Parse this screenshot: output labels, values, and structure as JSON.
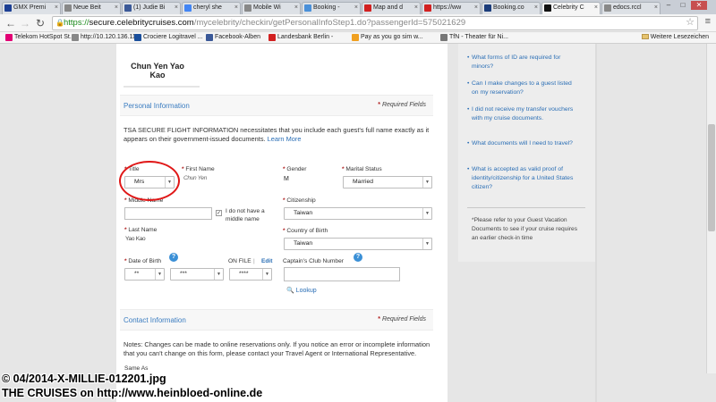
{
  "browser": {
    "tabs": [
      {
        "label": "GMX Premi",
        "favicon": "gmx-icon",
        "color": "#1c3f94",
        "active": false
      },
      {
        "label": "Neue Beit",
        "favicon": "page-icon",
        "color": "#888888",
        "active": false
      },
      {
        "label": "(1) Judie Bi",
        "favicon": "facebook-icon",
        "color": "#3b5998",
        "active": false
      },
      {
        "label": "cheryl she",
        "favicon": "search-icon",
        "color": "#4285f4",
        "active": false
      },
      {
        "label": "Mobile Wi",
        "favicon": "page-icon",
        "color": "#888888",
        "active": false
      },
      {
        "label": "Booking -",
        "favicon": "booking-icon",
        "color": "#4a90d9",
        "active": false
      },
      {
        "label": "Map and d",
        "favicon": "acrobat-icon",
        "color": "#d22020",
        "active": false
      },
      {
        "label": "https://ww",
        "favicon": "acrobat-icon",
        "color": "#d22020",
        "active": false
      },
      {
        "label": "Booking.co",
        "favicon": "booking-icon",
        "color": "#1b3c7a",
        "active": false
      },
      {
        "label": "Celebrity C",
        "favicon": "celebrity-x-icon",
        "color": "#111111",
        "active": true
      },
      {
        "label": "edocs.rccl",
        "favicon": "page-icon",
        "color": "#888888",
        "active": false
      }
    ],
    "url": {
      "https": "https://",
      "host": "secure.celebritycruises.com",
      "path": "/mycelebrity/checkin/getPersonalInfoStep1.do?passengerId=575021629"
    },
    "bookmarks": [
      {
        "label": "Telekom HotSpot St...",
        "color": "#e20074"
      },
      {
        "label": "http://10.120.136.11...",
        "color": "#888888"
      },
      {
        "label": "Crociere Logitravel ...",
        "color": "#1a4f9c"
      },
      {
        "label": "Facebook-Alben",
        "color": "#3b5998"
      },
      {
        "label": "Landesbank Berlin -",
        "color": "#d22020"
      },
      {
        "label": "Pay as you go sim w...",
        "color": "#f0a020"
      },
      {
        "label": "TfN - Theater für Ni...",
        "color": "#777777"
      }
    ],
    "other_bookmarks": "Weitere Lesezeichen"
  },
  "guest": {
    "first_line": "Chun Yen Yao",
    "second_line": "Kao"
  },
  "personal_info": {
    "section_title": "Personal Information",
    "required_note": "Required Fields",
    "tsa_text": "TSA SECURE FLIGHT INFORMATION necessitates that you include each guest's full name exactly as it appears on their government-issued documents.",
    "learn_more": "Learn More",
    "title_label": "Title",
    "title_value": "Mrs",
    "first_name_label": "First Name",
    "first_name_value": "Chun Yen",
    "gender_label": "Gender",
    "gender_value": "M",
    "marital_label": "Marital Status",
    "marital_value": "Married",
    "middle_name_label": "Middle Name",
    "no_middle_label": "I do not have a middle name",
    "citizenship_label": "Citizenship",
    "citizenship_value": "Taiwan",
    "last_name_label": "Last Name",
    "last_name_value": "Yao Kao",
    "country_label": "Country of Birth",
    "country_value": "Taiwan",
    "dob_label": "Date of Birth",
    "dob_month": "**",
    "dob_day": "***",
    "dob_year": "****",
    "on_file": "ON FILE",
    "edit": "Edit",
    "captains_club_label": "Captain's Club Number",
    "lookup": "Lookup"
  },
  "contact_info": {
    "section_title": "Contact Information",
    "required_note": "Required Fields",
    "notes_text": "Notes: Changes can be made to online reservations only. If you notice an error or incomplete information that you can't change on this form, please contact your Travel Agent or International Representative.",
    "same_as": "Same As"
  },
  "sidebar": {
    "links": [
      "What forms of ID are required for minors?",
      "Can I make changes to a guest listed on my reservation?",
      "I did not receive my transfer vouchers with my cruise documents.",
      "What documents will I need to travel?",
      "What is accepted as valid proof of identity/citizenship for a United States citizen?"
    ],
    "note": "*Please refer to your Guest Vacation Documents to see if your cruise requires an earlier check-in time"
  },
  "watermark": {
    "line1": "© 04/2014-X-MILLIE-012201.jpg",
    "line2": "THE CRUISES on http://www.heinbloed-online.de"
  },
  "colors": {
    "link": "#2a6eb5",
    "annotation_circle": "#e01717",
    "required_star": "#b02020"
  }
}
